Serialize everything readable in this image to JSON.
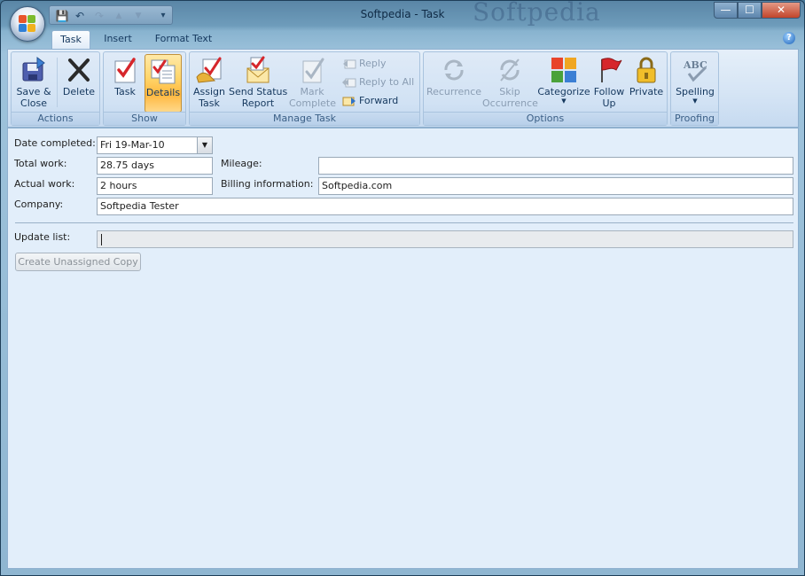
{
  "window": {
    "title": "Softpedia - Task",
    "watermark": "Softpedia"
  },
  "title_controls": {
    "minimize": "—",
    "maximize": "☐",
    "close": "✕"
  },
  "qat": [
    {
      "icon": "save-icon",
      "glyph": "💾"
    },
    {
      "icon": "undo-icon",
      "glyph": "↶"
    },
    {
      "icon": "redo-icon",
      "glyph": "↷"
    },
    {
      "icon": "up-arrow-icon",
      "glyph": "▲"
    },
    {
      "icon": "down-arrow-icon",
      "glyph": "▼"
    },
    {
      "icon": "customize-icon",
      "glyph": "▾"
    }
  ],
  "tabs": [
    {
      "label": "Task",
      "active": true
    },
    {
      "label": "Insert",
      "active": false
    },
    {
      "label": "Format Text",
      "active": false
    }
  ],
  "help": {
    "glyph": "?"
  },
  "ribbon": {
    "actions": {
      "label": "Actions",
      "save_close": "Save &\nClose",
      "delete": "Delete"
    },
    "show": {
      "label": "Show",
      "task": "Task",
      "details": "Details"
    },
    "manage_task": {
      "label": "Manage Task",
      "assign_task": "Assign\nTask",
      "send_status": "Send Status\nReport",
      "mark_complete": "Mark\nComplete",
      "reply": "Reply",
      "reply_all": "Reply to All",
      "forward": "Forward"
    },
    "options": {
      "label": "Options",
      "recurrence": "Recurrence",
      "skip_occurrence": "Skip\nOccurrence",
      "categorize": "Categorize",
      "follow_up": "Follow\nUp",
      "private": "Private"
    },
    "proofing": {
      "label": "Proofing",
      "spelling": "Spelling",
      "spelling_icon_text": "ABC"
    }
  },
  "form": {
    "date_completed": {
      "label": "Date completed:",
      "value": "Fri 19-Mar-10"
    },
    "total_work": {
      "label": "Total work:",
      "value": "28.75 days"
    },
    "actual_work": {
      "label": "Actual work:",
      "value": "2 hours"
    },
    "mileage": {
      "label": "Mileage:",
      "value": ""
    },
    "billing": {
      "label": "Billing information:",
      "value": "Softpedia.com"
    },
    "company": {
      "label": "Company:",
      "value": "Softpedia Tester"
    },
    "update_list": {
      "label": "Update list:",
      "value": ""
    },
    "create_copy": "Create Unassigned Copy"
  },
  "colors": {
    "accent": "#15385e",
    "selected": "#ffd66b",
    "disabled": "#8a9db3"
  }
}
